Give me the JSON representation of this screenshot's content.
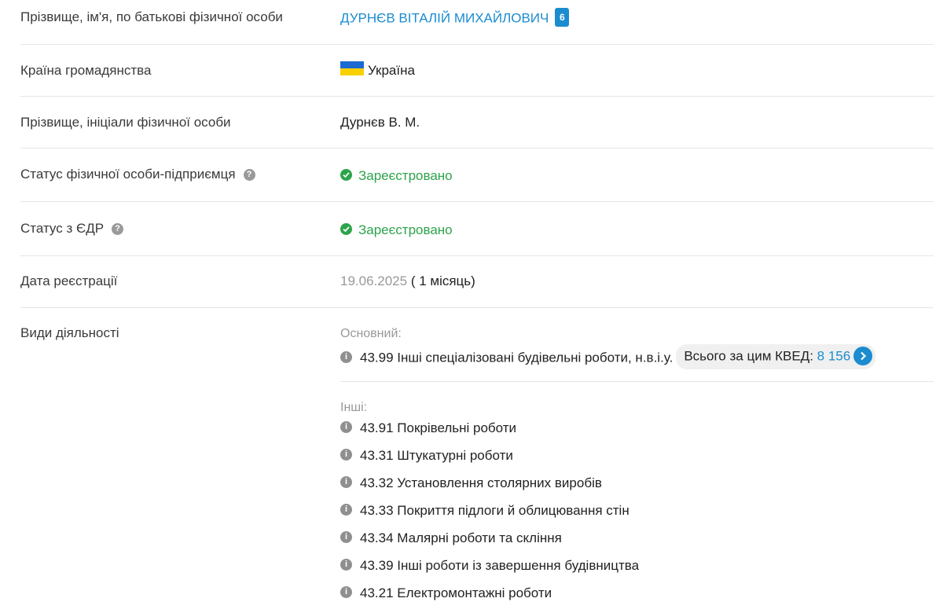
{
  "rows": {
    "full_name": {
      "label": "Прізвище, ім'я, по батькові фізичної особи",
      "value": "ДУРНЄВ ВІТАЛІЙ МИХАЙЛОВИЧ",
      "badge": "6"
    },
    "citizenship": {
      "label": "Країна громадянства",
      "value": "Україна"
    },
    "initials": {
      "label": "Прізвище, ініціали фізичної особи",
      "value": "Дурнєв В. М."
    },
    "fop_status": {
      "label": "Статус фізичної особи-підприємця",
      "value": "Зареєстровано"
    },
    "edr_status": {
      "label": "Статус з ЄДР",
      "value": "Зареєстровано"
    },
    "reg_date": {
      "label": "Дата реєстрації",
      "date": "19.06.2025",
      "duration": "( 1 місяць)"
    },
    "activities": {
      "label": "Види діяльності",
      "main_label": "Основний:",
      "main_item": "43.99 Інші спеціалізовані будівельні роботи, н.в.і.у.",
      "total_label": "Всього за цим КВЕД:",
      "total_count": "8 156",
      "other_label": "Інші:",
      "others": [
        "43.91 Покрівельні роботи",
        "43.31 Штукатурні роботи",
        "43.32 Установлення столярних виробів",
        "43.33 Покриття підлоги й облицювання стін",
        "43.34 Малярні роботи та скління",
        "43.39 Інші роботи із завершення будівництва",
        "43.21 Електромонтажні роботи"
      ]
    }
  },
  "icons": {
    "help": "question-circle-icon",
    "status_ok": "check-circle-icon",
    "info": "info-circle-icon",
    "arrow": "chevron-right-icon",
    "flag": "ukraine-flag-icon"
  },
  "colors": {
    "link": "#1a8ccf",
    "success": "#2ca44a",
    "muted": "#999999",
    "flag_blue": "#1b6ad2",
    "flag_yellow": "#f8d000"
  }
}
